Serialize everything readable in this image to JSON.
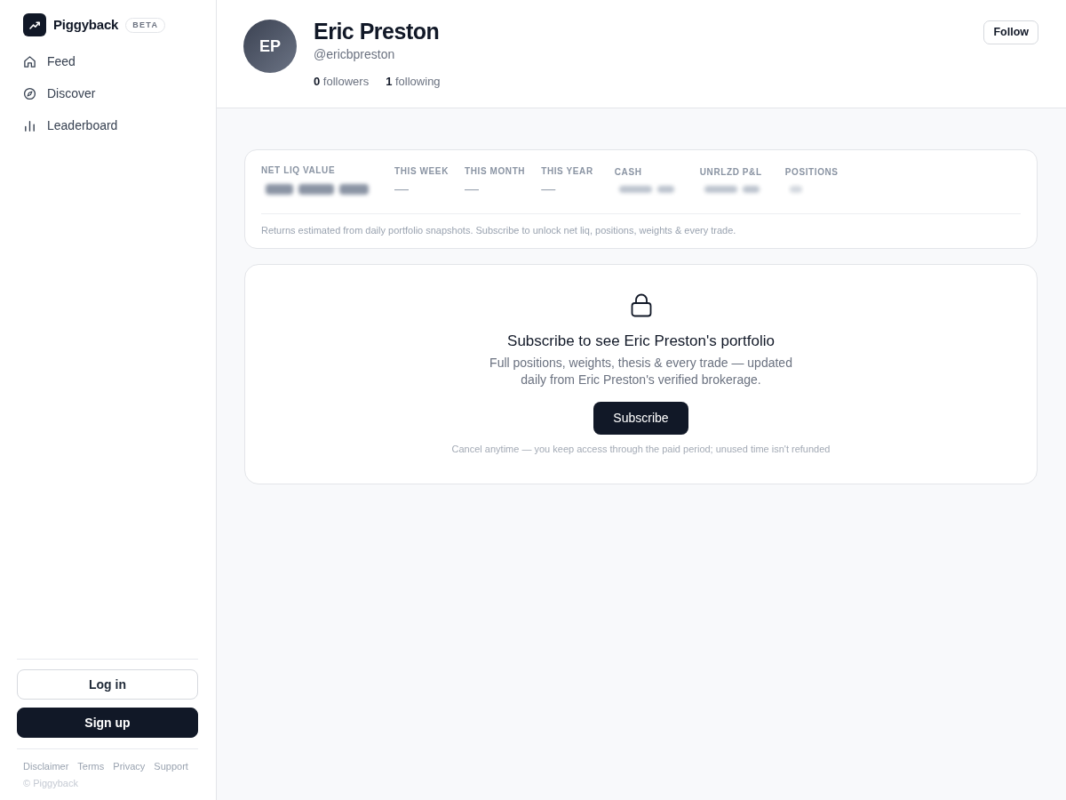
{
  "sidebar": {
    "brand": {
      "name": "Piggyback",
      "badge": "BETA"
    },
    "nav": [
      {
        "label": "Feed"
      },
      {
        "label": "Discover"
      },
      {
        "label": "Leaderboard"
      }
    ],
    "buttons": [
      {
        "label": "Log in",
        "kind": "outline"
      },
      {
        "label": "Sign up",
        "kind": "solid"
      }
    ],
    "footer_links": [
      "Disclaimer",
      "Terms",
      "Privacy",
      "Support"
    ],
    "copyright": "© Piggyback"
  },
  "profile": {
    "initials": "EP",
    "name": "Eric Preston",
    "handle": "@ericbpreston",
    "followers": "**0** followers",
    "following": "**1** following",
    "follow_button": "Follow"
  },
  "stats": {
    "items": [
      {
        "label": "NET LIQ VALUE",
        "kind": "masked"
      },
      {
        "label": "THIS WEEK",
        "kind": "text",
        "value": "—"
      },
      {
        "label": "THIS MONTH",
        "kind": "text",
        "value": "—"
      },
      {
        "label": "THIS YEAR",
        "kind": "text",
        "value": "—"
      },
      {
        "label": "CASH",
        "kind": "masked"
      },
      {
        "label": "UNRLZD P&L",
        "kind": "masked"
      },
      {
        "label": "POSITIONS",
        "kind": "masked"
      }
    ],
    "note": "Returns estimated from daily portfolio snapshots. Subscribe to unlock net liq, positions, weights & every trade."
  },
  "paywall": {
    "title": "Subscribe to see Eric Preston's portfolio",
    "description": "Full positions, weights, thesis & every trade — updated daily from Eric Preston's verified brokerage.",
    "button": "Subscribe",
    "fine_print": "Cancel anytime — you keep access through the paid period; unused time isn't refunded"
  }
}
